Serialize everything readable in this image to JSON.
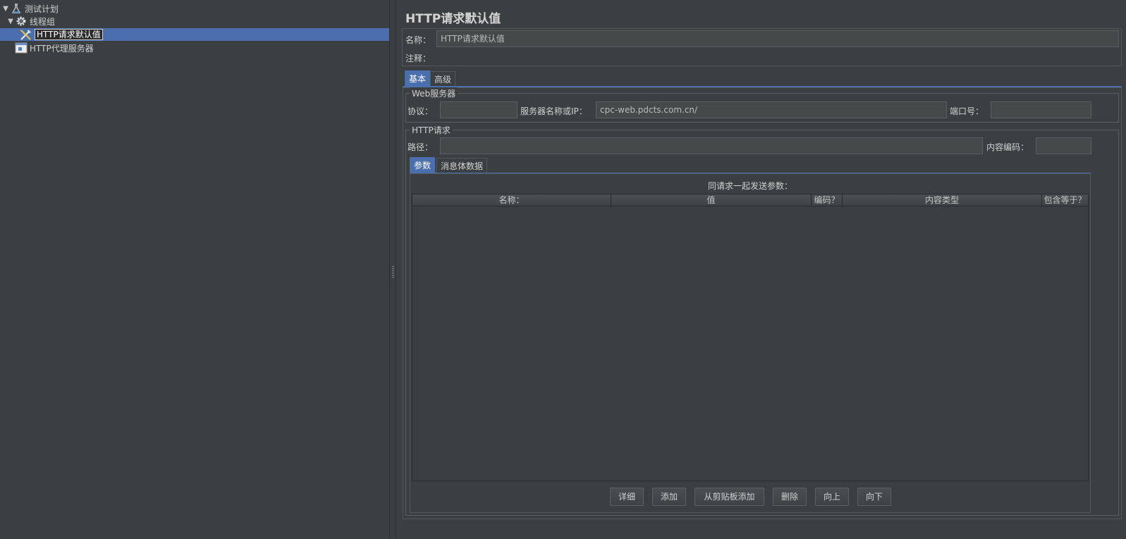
{
  "tree": {
    "items": [
      {
        "label": "测试计划",
        "icon": "flask-icon",
        "expanded": true
      },
      {
        "label": "线程组",
        "icon": "gear-icon",
        "expanded": true
      },
      {
        "label": "HTTP请求默认值",
        "icon": "wrench-icon",
        "selected": true
      },
      {
        "label": "HTTP代理服务器",
        "icon": "proxy-server-icon"
      }
    ]
  },
  "panel": {
    "title": "HTTP请求默认值",
    "name_label": "名称：",
    "name_value": "HTTP请求默认值",
    "comment_label": "注释：",
    "tabs": [
      "基本",
      "高级"
    ],
    "active_tab": "基本"
  },
  "web_server": {
    "group_title": "Web服务器",
    "protocol_label": "协议：",
    "protocol_value": "",
    "server_label": "服务器名称或IP：",
    "server_value": "cpc-web.pdcts.com.cn/",
    "port_label": "端口号：",
    "port_value": ""
  },
  "http_request": {
    "group_title": "HTTP请求",
    "path_label": "路径：",
    "path_value": "",
    "encoding_label": "内容编码：",
    "encoding_value": "",
    "tabs": [
      "参数",
      "消息体数据"
    ],
    "active_tab": "参数"
  },
  "params_table": {
    "caption": "同请求一起发送参数：",
    "columns": [
      "名称：",
      "值",
      "编码？",
      "内容类型",
      "包含等于？"
    ],
    "rows": []
  },
  "buttons": {
    "detail": "详细",
    "add": "添加",
    "add_from_clipboard": "从剪贴板添加",
    "delete": "删除",
    "up": "向上",
    "down": "向下"
  },
  "colors": {
    "background": "#3c3f41",
    "selection": "#4b6eaf",
    "field_bg": "#45494a"
  }
}
